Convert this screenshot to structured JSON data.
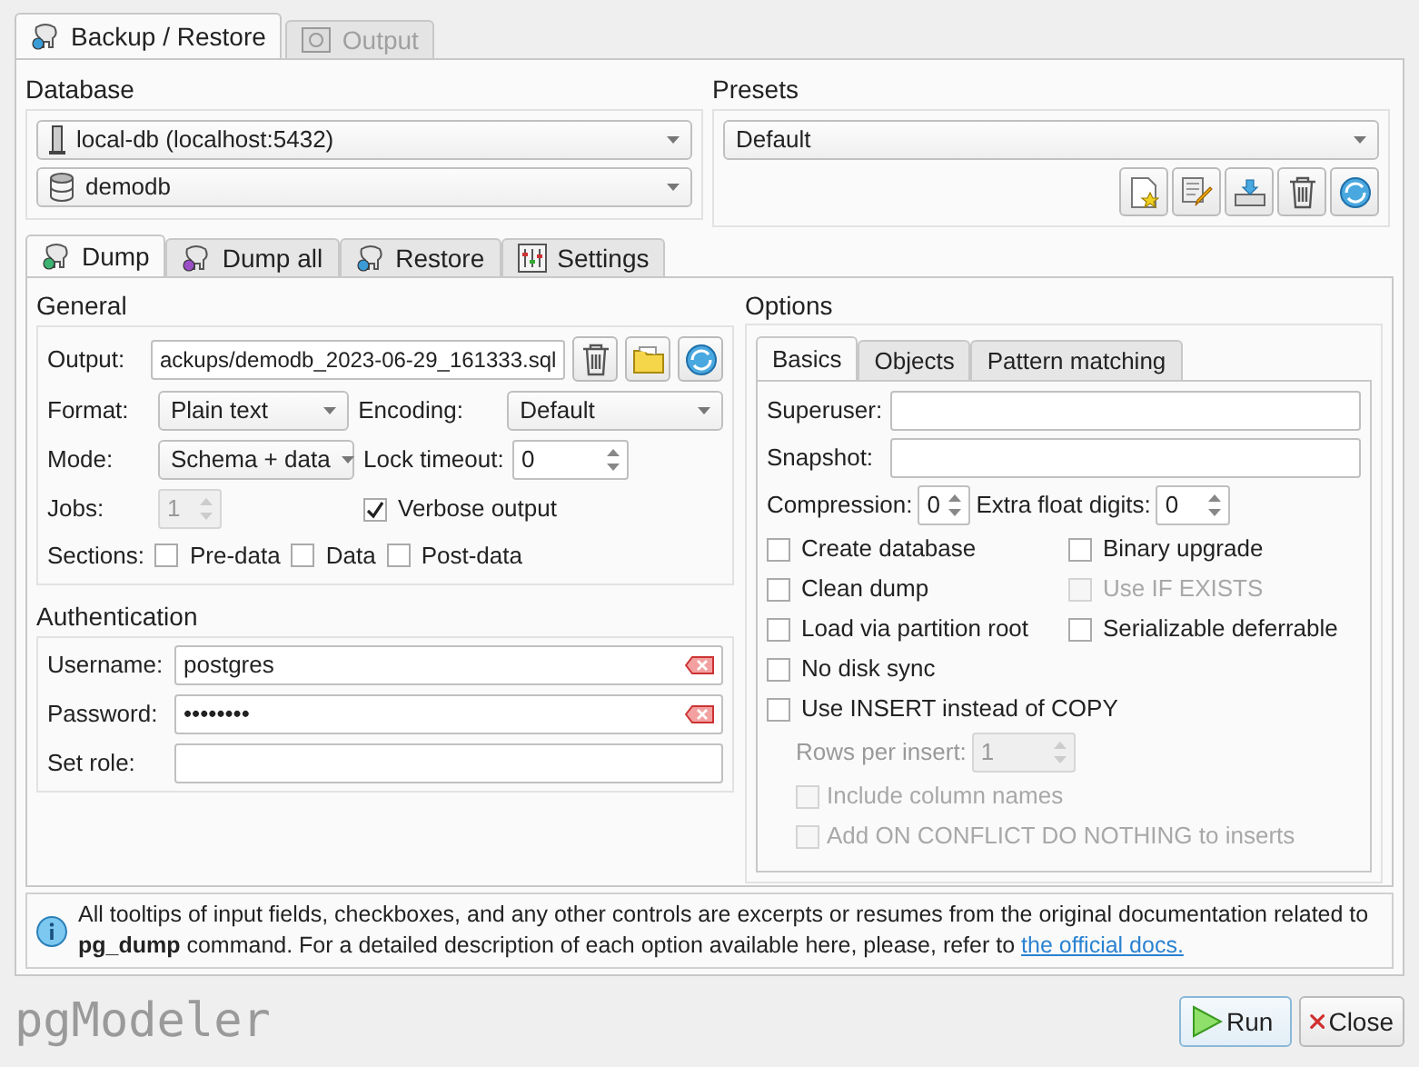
{
  "main_tabs": [
    {
      "label": "Backup / Restore",
      "selected": true,
      "disabled": false
    },
    {
      "label": "Output",
      "selected": false,
      "disabled": true
    }
  ],
  "database": {
    "title": "Database",
    "connection": "local-db (localhost:5432)",
    "database": "demodb"
  },
  "presets": {
    "title": "Presets",
    "value": "Default"
  },
  "mode_tabs": [
    {
      "label": "Dump",
      "selected": true
    },
    {
      "label": "Dump all",
      "selected": false
    },
    {
      "label": "Restore",
      "selected": false
    },
    {
      "label": "Settings",
      "selected": false
    }
  ],
  "general": {
    "title": "General",
    "output": {
      "label": "Output:",
      "value": "ackups/demodb_2023-06-29_161333.sql"
    },
    "format": {
      "label": "Format:",
      "value": "Plain text"
    },
    "encoding": {
      "label": "Encoding:",
      "value": "Default"
    },
    "mode": {
      "label": "Mode:",
      "value": "Schema + data"
    },
    "lock_timeout": {
      "label": "Lock timeout:",
      "value": "0"
    },
    "jobs": {
      "label": "Jobs:",
      "value": "1",
      "disabled": true
    },
    "verbose": {
      "label": "Verbose output",
      "checked": true
    },
    "sections": {
      "label": "Sections:",
      "items": [
        {
          "label": "Pre-data",
          "checked": false
        },
        {
          "label": "Data",
          "checked": false
        },
        {
          "label": "Post-data",
          "checked": false
        }
      ]
    }
  },
  "authentication": {
    "title": "Authentication",
    "fields": [
      {
        "label": "Username:",
        "value": "postgres",
        "clearable": true
      },
      {
        "label": "Password:",
        "value": "••••••••",
        "clearable": true
      },
      {
        "label": "Set role:",
        "clearable": false
      }
    ]
  },
  "options": {
    "title": "Options",
    "tabs": [
      {
        "label": "Basics",
        "selected": true
      },
      {
        "label": "Objects",
        "selected": false
      },
      {
        "label": "Pattern matching",
        "selected": false
      }
    ],
    "superuser": {
      "label": "Superuser:"
    },
    "snapshot": {
      "label": "Snapshot:"
    },
    "compression": {
      "label": "Compression:",
      "value": "0"
    },
    "extra_float_digits": {
      "label": "Extra float digits:",
      "value": "0"
    },
    "checkbox_grid": [
      {
        "label": "Create database",
        "checked": false,
        "disabled": false
      },
      {
        "label": "Binary upgrade",
        "checked": false,
        "disabled": false
      },
      {
        "label": "Clean dump",
        "checked": false,
        "disabled": false
      },
      {
        "label": "Use IF EXISTS",
        "checked": false,
        "disabled": true
      },
      {
        "label": "Load via partition root",
        "checked": false,
        "disabled": false
      },
      {
        "label": "Serializable deferrable",
        "checked": false,
        "disabled": false
      }
    ],
    "checkboxes": [
      {
        "label": "No disk sync",
        "checked": false,
        "disabled": false
      },
      {
        "label": "Use INSERT instead of COPY",
        "checked": false,
        "disabled": false
      }
    ],
    "rows_per_insert": {
      "label": "Rows per insert:",
      "value": "1",
      "disabled": true
    },
    "insert_options": [
      {
        "label": "Include column names",
        "checked": false,
        "disabled": true
      },
      {
        "label": "Add ON CONFLICT DO NOTHING to inserts",
        "checked": false,
        "disabled": true
      }
    ]
  },
  "info": {
    "text": "All tooltips of input fields, checkboxes, and any other controls are excerpts or resumes from the original documentation related to **pg_dump** command. For a detailed description of each option available here, please, refer to",
    "link": "the official docs."
  },
  "footer": {
    "logo": "pgModeler",
    "buttons": [
      {
        "label": "Run",
        "kind": "run"
      },
      {
        "label": "Close",
        "kind": "close"
      }
    ]
  }
}
